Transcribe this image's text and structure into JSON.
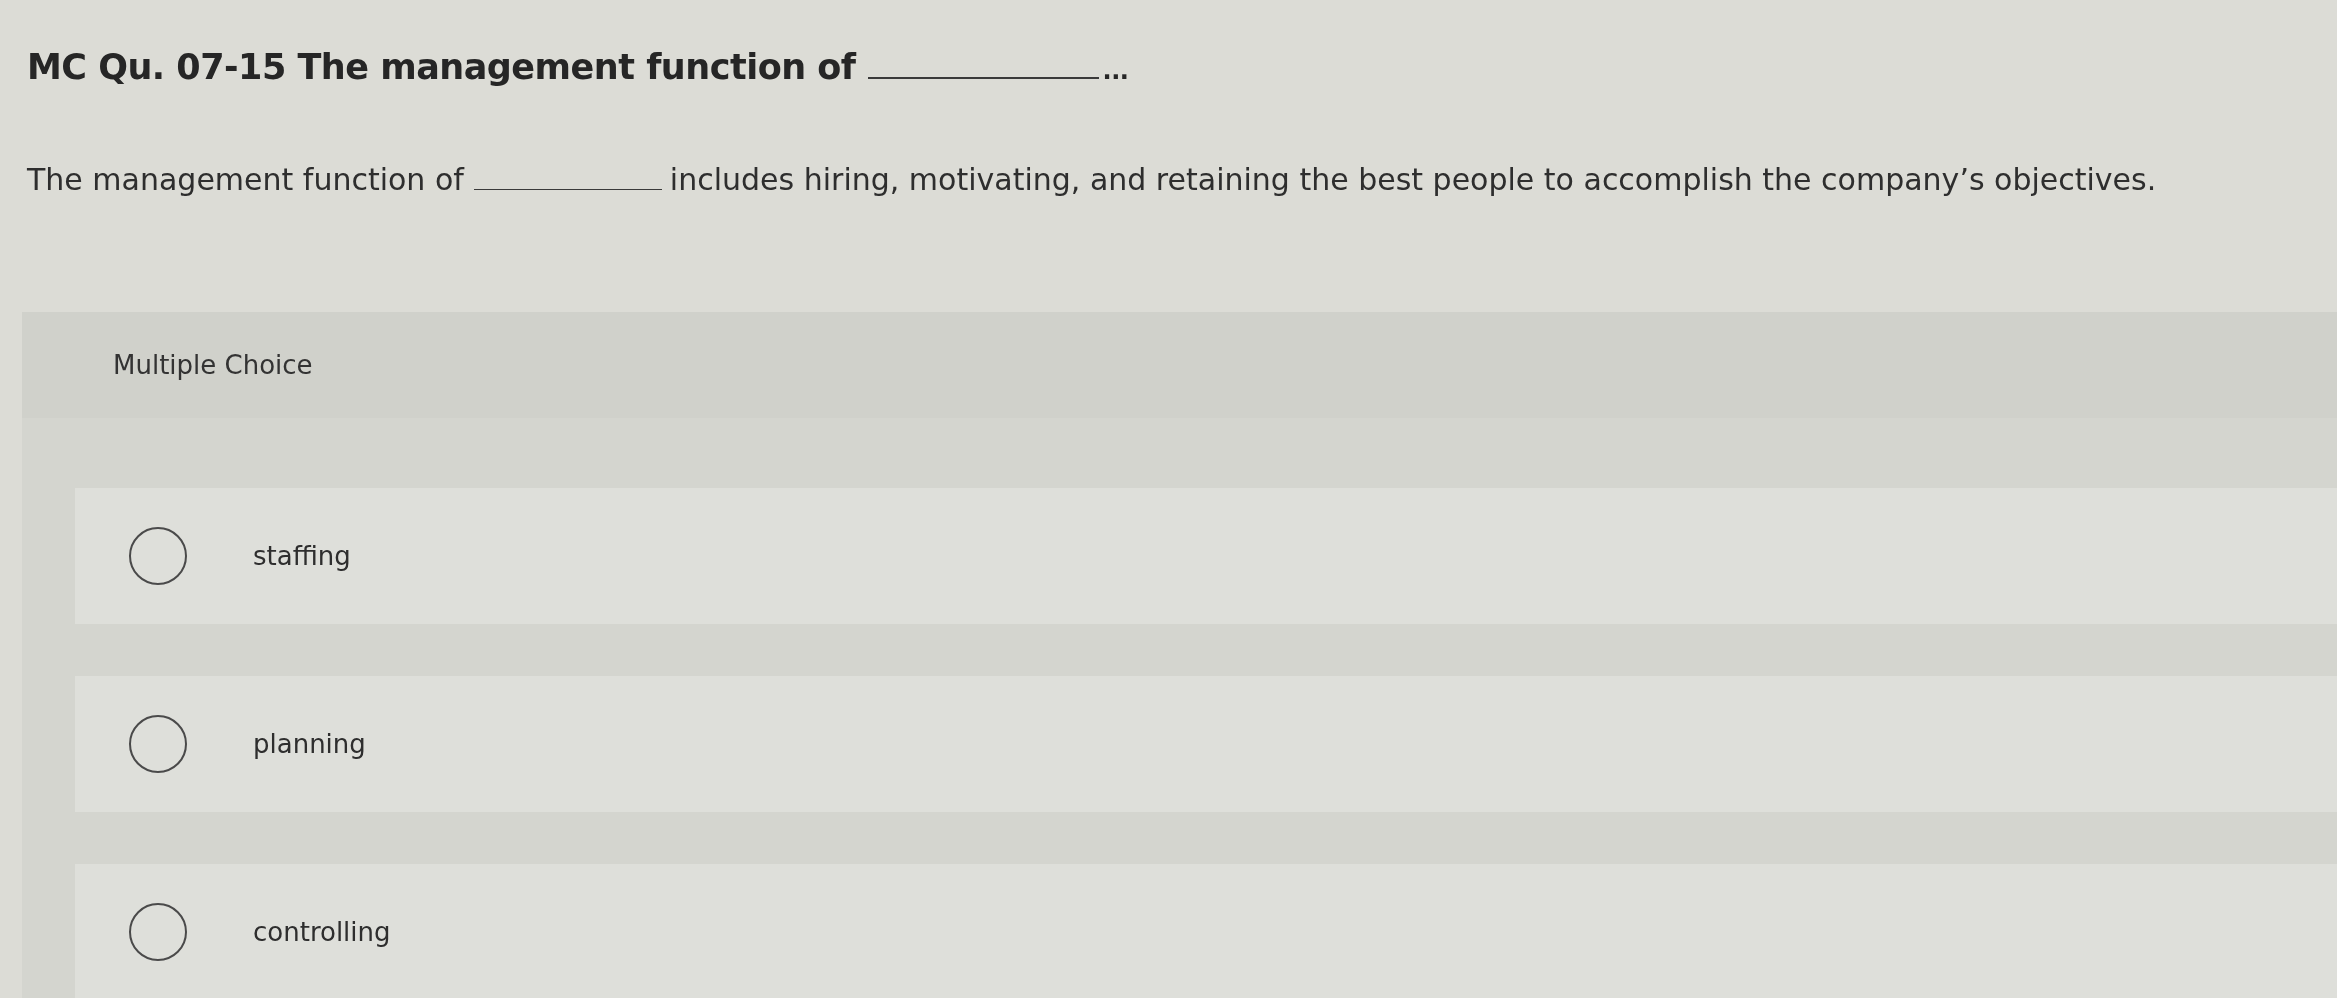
{
  "question": {
    "title": [
      {
        "kind": "text",
        "text": "MC Qu. 07-15 The management function of"
      },
      {
        "kind": "blank"
      },
      {
        "kind": "ellipsis",
        "text": "..."
      }
    ],
    "prompt": [
      {
        "kind": "text",
        "text": "The management function of"
      },
      {
        "kind": "blank"
      },
      {
        "kind": "text",
        "text": "includes hiring, motivating, and retaining the best people to accomplish the company’s objectives."
      }
    ]
  },
  "answer_panel": {
    "header": "Multiple Choice",
    "options": [
      {
        "label": "staffing",
        "selected": false
      },
      {
        "label": "planning",
        "selected": false
      },
      {
        "label": "controlling",
        "selected": false
      }
    ]
  }
}
